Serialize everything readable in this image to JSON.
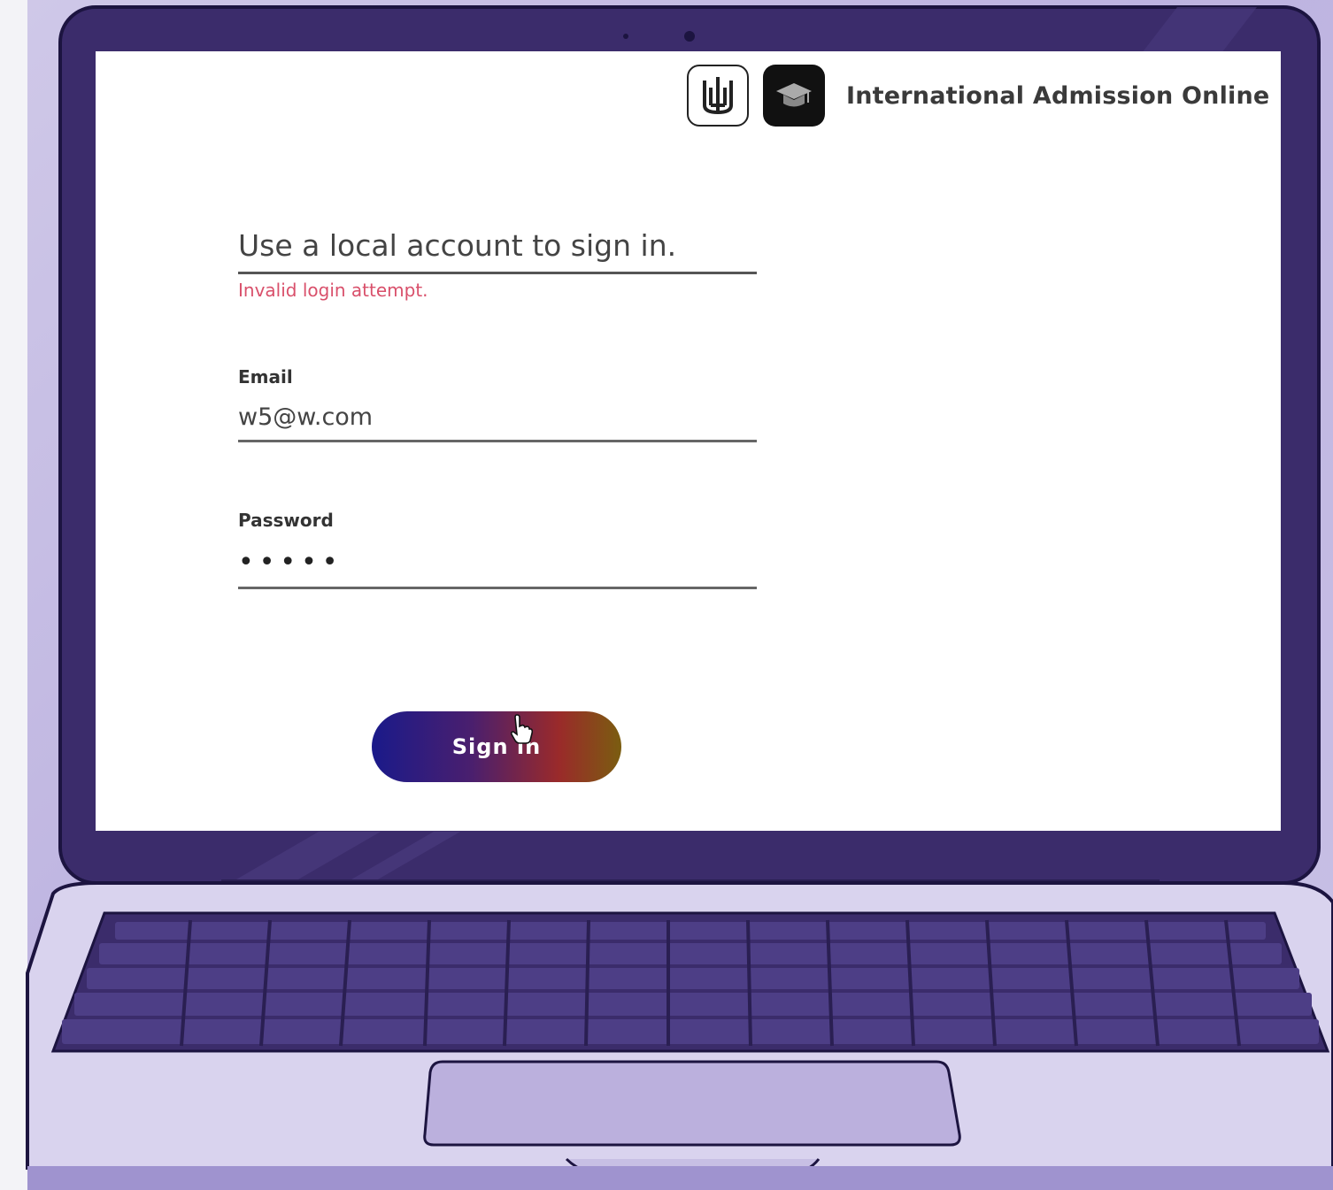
{
  "header": {
    "app_title": "International Admission Online",
    "logo_left_icon": "trident-icon",
    "logo_right_icon": "graduation-cap-icon"
  },
  "form": {
    "heading": "Use a local account to sign in.",
    "error_message": "Invalid login attempt.",
    "email_label": "Email",
    "email_value": "w5@w.com",
    "password_label": "Password",
    "password_value": "•••••",
    "sign_in_label": "Sign in"
  },
  "colors": {
    "error": "#d9506b",
    "laptop_body": "#3a2d6a",
    "background_accent": "#bdb3e0"
  }
}
